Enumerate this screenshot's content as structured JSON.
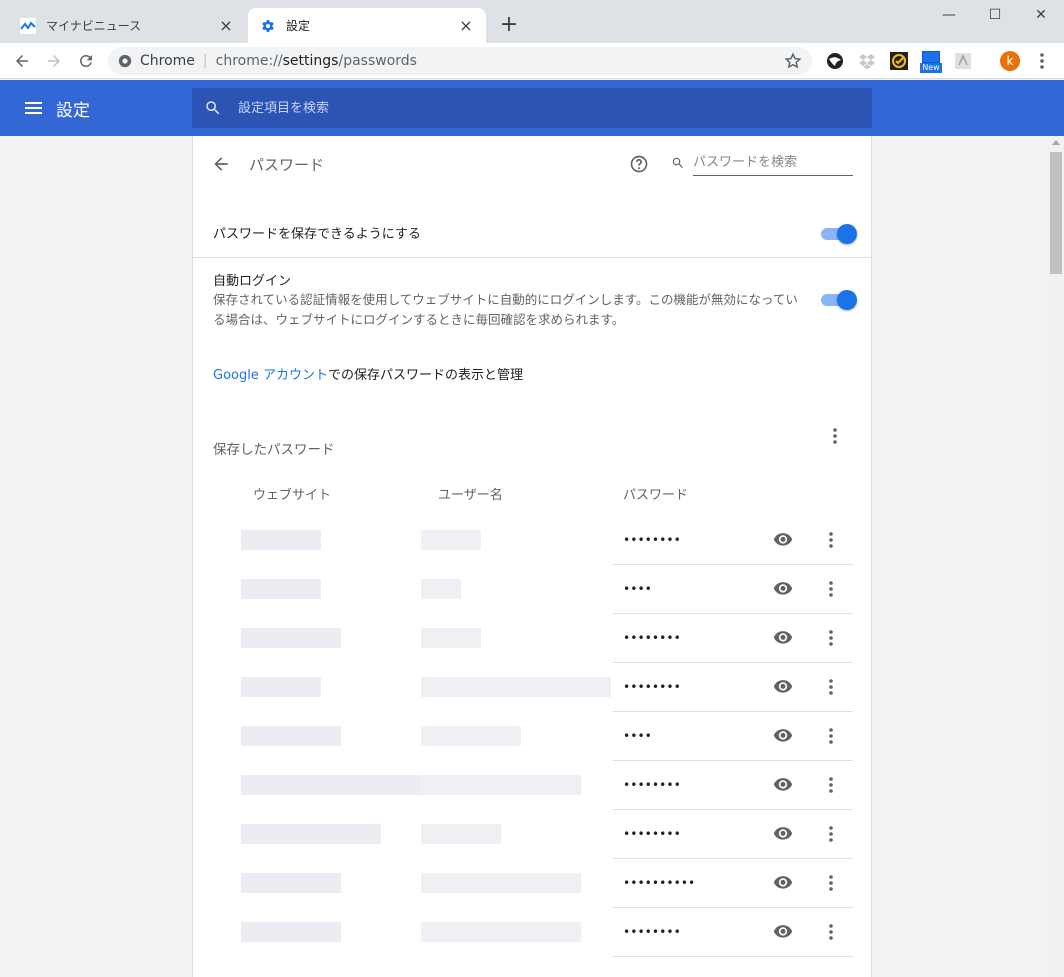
{
  "tabs": [
    {
      "title": "マイナビニュース",
      "close": "×"
    },
    {
      "title": "設定",
      "close": "×"
    }
  ],
  "new_tab": "+",
  "window_controls": {
    "minimize": "—",
    "maximize": "☐",
    "close": "✕"
  },
  "omnibox": {
    "chrome_label": "Chrome",
    "separator": "|",
    "url_scheme": "chrome://",
    "url_host": "settings",
    "url_path": "/passwords"
  },
  "profile_initial": "k",
  "extension_new_badge": "New",
  "settings": {
    "title": "設定",
    "search_placeholder": "設定項目を検索"
  },
  "passwords_page": {
    "title": "パスワード",
    "search_placeholder": "パスワードを検索",
    "save_passwords_label": "パスワードを保存できるようにする",
    "save_passwords_enabled": true,
    "auto_login_label": "自動ログイン",
    "auto_login_desc": "保存されている認証情報を使用してウェブサイトに自動的にログインします。この機能が無効になっている場合は、ウェブサイトにログインするときに毎回確認を求められます。",
    "auto_login_enabled": true,
    "google_link": "Google アカウント",
    "google_link_suffix": "での保存パスワードの表示と管理",
    "saved_heading": "保存したパスワード",
    "columns": {
      "website": "ウェブサイト",
      "username": "ユーザー名",
      "password": "パスワード"
    },
    "rows": [
      {
        "password": "••••••••"
      },
      {
        "password": "••••"
      },
      {
        "password": "••••••••"
      },
      {
        "password": "••••••••"
      },
      {
        "password": "••••"
      },
      {
        "password": "••••••••"
      },
      {
        "password": "••••••••"
      },
      {
        "password": "••••••••••"
      },
      {
        "password": "••••••••"
      }
    ]
  },
  "colors": {
    "header_blue": "#3367d6",
    "toggle_blue": "#1a73e8",
    "link_blue": "#1a73e8"
  }
}
